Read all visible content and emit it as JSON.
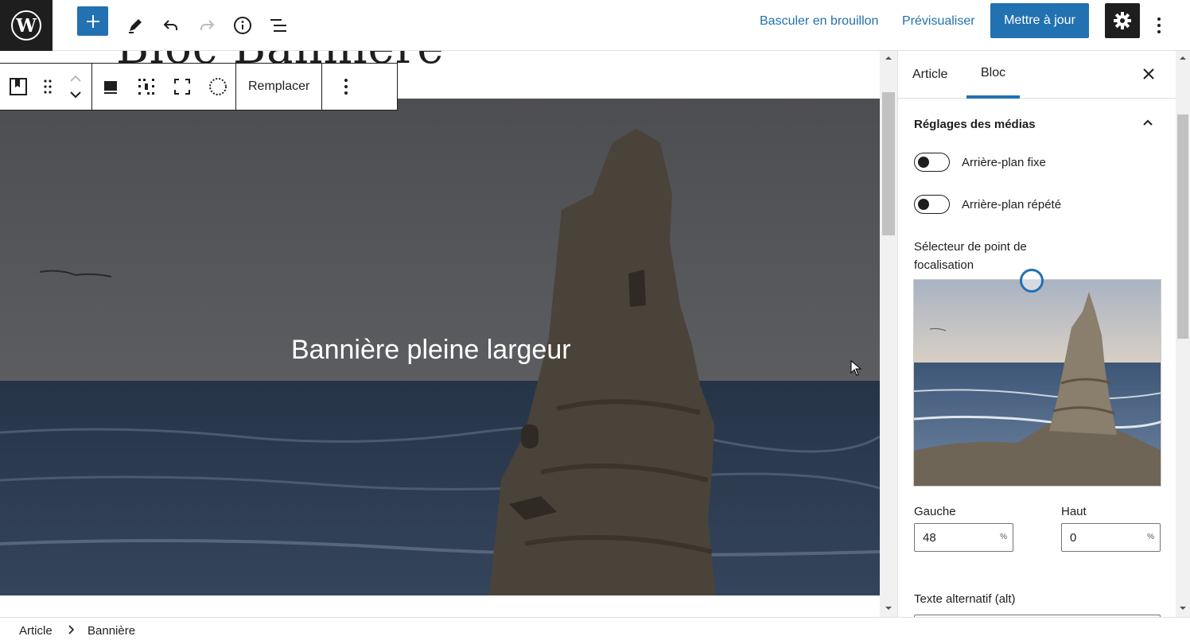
{
  "header": {
    "switch_to_draft": "Basculer en brouillon",
    "preview": "Prévisualiser",
    "update": "Mettre à jour"
  },
  "post": {
    "title": "Bloc Bannière"
  },
  "block_toolbar": {
    "replace_label": "Remplacer"
  },
  "cover": {
    "text": "Bannière pleine largeur"
  },
  "sidebar": {
    "tabs": [
      {
        "label": "Article"
      },
      {
        "label": "Bloc"
      }
    ],
    "panel_title": "Réglages des médias",
    "toggles": [
      {
        "label": "Arrière-plan fixe",
        "checked": false
      },
      {
        "label": "Arrière-plan répété",
        "checked": false
      }
    ],
    "focal_label": "Sélecteur de point de focalisation",
    "left_label": "Gauche",
    "left_value": "48",
    "top_label": "Haut",
    "top_value": "0",
    "unit": "%",
    "alt_label": "Texte alternatif (alt)"
  },
  "breadcrumb": [
    {
      "label": "Article"
    },
    {
      "label": "Bannière"
    }
  ],
  "colors": {
    "accent": "#2271b1",
    "dark": "#1e1e1e"
  }
}
